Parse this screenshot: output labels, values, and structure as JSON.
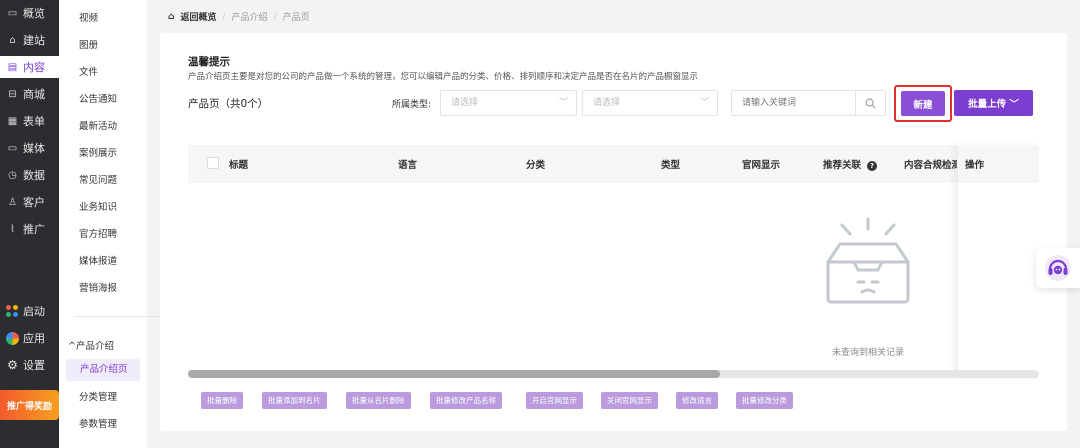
{
  "nav": {
    "items": [
      {
        "icon": "monitor-icon",
        "glyph": "▭",
        "label": "概览"
      },
      {
        "icon": "home-icon",
        "glyph": "⌂",
        "label": "建站"
      },
      {
        "icon": "document-icon",
        "glyph": "▤",
        "label": "内容",
        "active": true
      },
      {
        "icon": "shop-icon",
        "glyph": "⊟",
        "label": "商城"
      },
      {
        "icon": "form-icon",
        "glyph": "▦",
        "label": "表单"
      },
      {
        "icon": "media-icon",
        "glyph": "▭",
        "label": "媒体"
      },
      {
        "icon": "clock-icon",
        "glyph": "◷",
        "label": "数据"
      },
      {
        "icon": "user-icon",
        "glyph": "♙",
        "label": "客户"
      },
      {
        "icon": "link-icon",
        "glyph": "⌇",
        "label": "推广"
      }
    ],
    "bottom": [
      {
        "icon": "launch-icon",
        "label": "启动"
      },
      {
        "icon": "apps-icon",
        "label": "应用"
      },
      {
        "icon": "gear-icon",
        "label": "设置"
      }
    ],
    "promo": "推广得奖励"
  },
  "subnav": {
    "items": [
      "视频",
      "图册",
      "文件",
      "公告通知",
      "最新活动",
      "案例展示",
      "常见问题",
      "业务知识",
      "官方招聘",
      "媒体报道",
      "营销海报"
    ],
    "group": "^产品介绍",
    "active": "产品介绍页",
    "after": [
      "分类管理",
      "参数管理"
    ]
  },
  "breadcrumb": {
    "back": "返回概览",
    "sep": "/",
    "level1": "产品介绍",
    "level2": "产品页"
  },
  "tip": {
    "title": "温馨提示",
    "text": "产品介绍页主要是对您的公司的产品做一个系统的管理，您可以编辑产品的分类、价格、排列顺序和决定产品是否在名片的产品橱窗显示"
  },
  "list": {
    "count": "产品页（共0个）"
  },
  "filters": {
    "type_label": "所属类型:",
    "select1_placeholder": "请选择",
    "select2_placeholder": "请选择",
    "search_placeholder": "请输入关键词"
  },
  "actions": {
    "new": "新建",
    "batch_upload": "批量上传 ﹀"
  },
  "table": {
    "columns": [
      "标题",
      "语言",
      "分类",
      "类型",
      "官网显示",
      "推荐关联",
      "内容合规检测",
      "操作"
    ],
    "empty": "未查询到相关记录"
  },
  "bulk_actions": [
    "批量删除",
    "批量添加到名片",
    "批量从名片删除",
    "批量修改产品名称",
    "开启官网显示",
    "关闭官网显示",
    "修改语言",
    "批量修改分类"
  ],
  "colors": {
    "accent": "#7c3ed1",
    "nav_bg": "#2b2d31",
    "highlight_border": "#e0312e"
  }
}
